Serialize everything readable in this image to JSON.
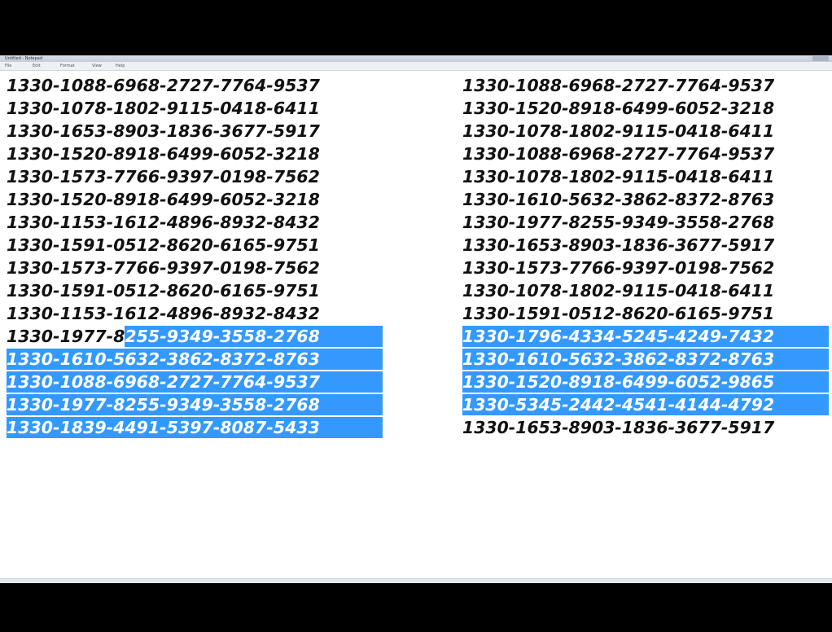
{
  "window": {
    "title": "Untitled - Notepad",
    "menu": [
      "File",
      "Edit",
      "Format",
      "View",
      "Help"
    ]
  },
  "colors": {
    "selection": "#3399ff",
    "text": "#111111",
    "background": "#ffffff"
  },
  "left_column": [
    {
      "text": "1330-1088-6968-2727-7764-9537"
    },
    {
      "text": "1330-1078-1802-9115-0418-6411"
    },
    {
      "text": "1330-1653-8903-1836-3677-5917"
    },
    {
      "text": "1330-1520-8918-6499-6052-3218"
    },
    {
      "text": "1330-1573-7766-9397-0198-7562"
    },
    {
      "text": "1330-1520-8918-6499-6052-3218"
    },
    {
      "text": "1330-1153-1612-4896-8932-8432"
    },
    {
      "text": "1330-1591-0512-8620-6165-9751"
    },
    {
      "text": "1330-1573-7766-9397-0198-7562"
    },
    {
      "text": "1330-1591-0512-8620-6165-9751"
    },
    {
      "text": "1330-1153-1612-4896-8932-8432"
    },
    {
      "text": "1330-1977-8255-9349-3558-2768",
      "unselected_part": "1330-1977-8",
      "selected_part": "255-9349-3558-2768"
    },
    {
      "text": "1330-1610-5632-3862-8372-8763",
      "selected": true
    },
    {
      "text": "1330-1088-6968-2727-7764-9537",
      "selected": true
    },
    {
      "text": "1330-1977-8255-9349-3558-2768",
      "selected": true
    },
    {
      "text": "1330-1839-4491-5397-8087-5433",
      "selected": true
    }
  ],
  "right_column": [
    {
      "text": "1330-1088-6968-2727-7764-9537"
    },
    {
      "text": "1330-1520-8918-6499-6052-3218"
    },
    {
      "text": "1330-1078-1802-9115-0418-6411"
    },
    {
      "text": "1330-1088-6968-2727-7764-9537"
    },
    {
      "text": "1330-1078-1802-9115-0418-6411"
    },
    {
      "text": "1330-1610-5632-3862-8372-8763"
    },
    {
      "text": "1330-1977-8255-9349-3558-2768"
    },
    {
      "text": "1330-1653-8903-1836-3677-5917"
    },
    {
      "text": "1330-1573-7766-9397-0198-7562"
    },
    {
      "text": "1330-1078-1802-9115-0418-6411"
    },
    {
      "text": "1330-1591-0512-8620-6165-9751"
    },
    {
      "text": "1330-1796-4334-5245-4249-7432",
      "selected": true
    },
    {
      "text": "1330-1610-5632-3862-8372-8763",
      "selected": true
    },
    {
      "text": "1330-1520-8918-6499-6052-9865",
      "selected": true
    },
    {
      "text": "1330-5345-2442-4541-4144-4792",
      "selected": true
    },
    {
      "text": "1330-1653-8903-1836-3677-5917"
    }
  ]
}
